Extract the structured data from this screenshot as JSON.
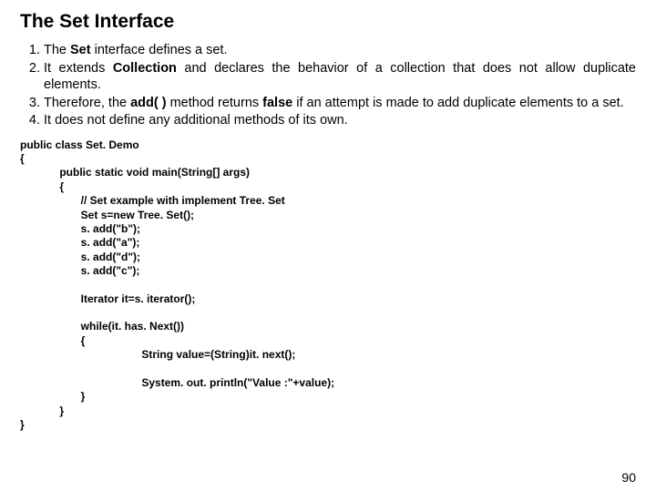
{
  "title": "The Set Interface",
  "points": {
    "p1a": "The ",
    "p1b": "Set",
    "p1c": " interface defines a set.",
    "p2a": "It extends ",
    "p2b": "Collection",
    "p2c": " and declares the behavior of a collection that does not allow duplicate elements.",
    "p3a": "Therefore, the ",
    "p3b": "add( )",
    "p3c": " method returns ",
    "p3d": "false",
    "p3e": " if an attempt is made to add duplicate elements to a set.",
    "p4": "It does not define any  additional methods of its own."
  },
  "code": "public class Set. Demo\n{\n             public static void main(String[] args)\n             {\n                    // Set example with implement Tree. Set\n                    Set s=new Tree. Set();\n                    s. add(\"b\");\n                    s. add(\"a\");\n                    s. add(\"d\");\n                    s. add(\"c\");\n\n                    Iterator it=s. iterator();\n\n                    while(it. has. Next())\n                    {\n                                        String value=(String)it. next();\n\n                                        System. out. println(\"Value :\"+value);\n                    }\n             }\n}",
  "slide_number": "90"
}
